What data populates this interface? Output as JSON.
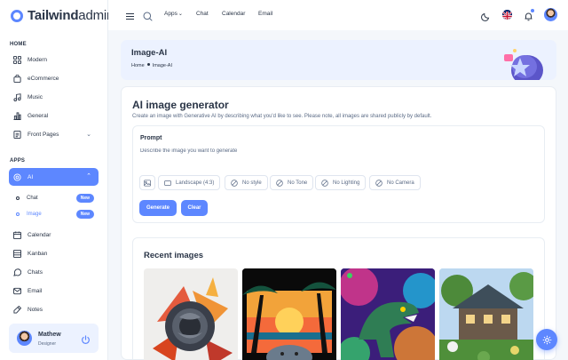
{
  "brand": {
    "name_bold": "Tailwind",
    "name_thin": "admin"
  },
  "sidebar": {
    "home_heading": "HOME",
    "home_items": [
      {
        "label": "Modern",
        "icon": "grid-icon"
      },
      {
        "label": "eCommerce",
        "icon": "shopping-bag-icon"
      },
      {
        "label": "Music",
        "icon": "music-icon"
      },
      {
        "label": "General",
        "icon": "chart-bar-icon"
      },
      {
        "label": "Front Pages",
        "icon": "file-text-icon"
      }
    ],
    "apps_heading": "APPS",
    "ai_item": {
      "label": "AI",
      "icon": "brain-icon"
    },
    "ai_sub": [
      {
        "label": "Chat",
        "badge": "New"
      },
      {
        "label": "Image",
        "badge": "New"
      }
    ],
    "apps_items": [
      {
        "label": "Calendar",
        "icon": "calendar-icon"
      },
      {
        "label": "Kanban",
        "icon": "kanban-icon"
      },
      {
        "label": "Chats",
        "icon": "message-icon"
      },
      {
        "label": "Email",
        "icon": "mail-icon"
      },
      {
        "label": "Notes",
        "icon": "note-icon"
      }
    ],
    "profile": {
      "name": "Mathew",
      "role": "Designer"
    }
  },
  "topbar": {
    "links": [
      "Apps",
      "Chat",
      "Calendar",
      "Email"
    ],
    "apps_chevron": "⌄"
  },
  "banner": {
    "title": "Image-AI",
    "crumb_home": "Home",
    "crumb_current": "Image-AI"
  },
  "generator": {
    "title": "AI image generator",
    "description": "Create an image with Generative AI by describing what you'd like to see. Please note, all images are shared publicly by default.",
    "prompt_label": "Prompt",
    "prompt_placeholder": "Describe the image you want to generate",
    "options": [
      "Landscape (4:3)",
      "No style",
      "No Tone",
      "No Lighting",
      "No Camera"
    ],
    "generate_label": "Generate",
    "clear_label": "Clear"
  },
  "recent": {
    "title": "Recent images",
    "images": [
      "rose-artwork",
      "palm-sunset-artwork",
      "dinosaur-psychedelic-artwork",
      "cottage-landscape-artwork"
    ]
  },
  "colors": {
    "primary": "#5d87ff",
    "primary_light": "#ecf2ff",
    "text": "#2a3547",
    "muted": "#5a6a85"
  }
}
